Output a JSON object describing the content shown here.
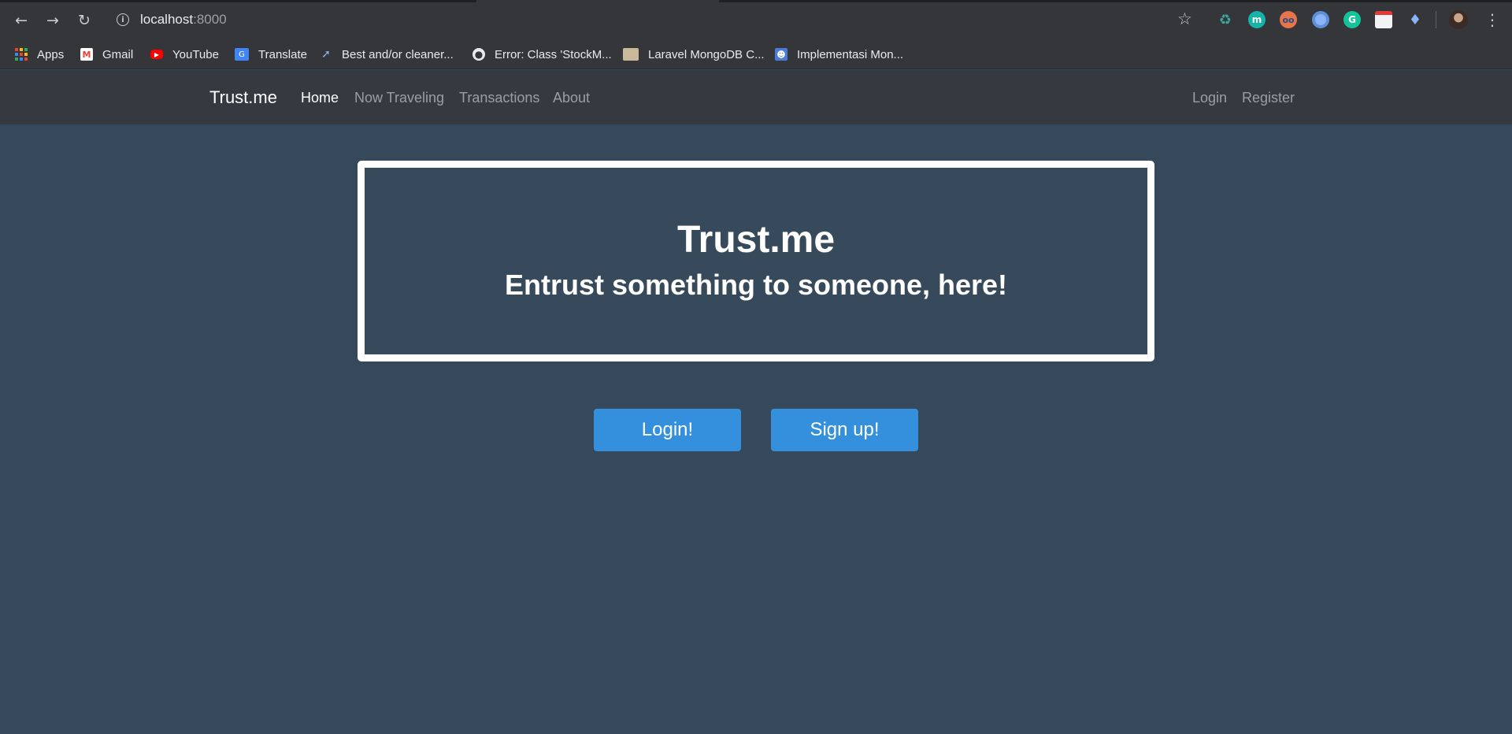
{
  "browser": {
    "url_host": "localhost",
    "url_port": ":8000",
    "bookmarks": [
      {
        "label": "Apps",
        "icon": "apps-grid-icon"
      },
      {
        "label": "Gmail",
        "icon": "gmail-icon"
      },
      {
        "label": "YouTube",
        "icon": "youtube-icon"
      },
      {
        "label": "Translate",
        "icon": "google-translate-icon"
      },
      {
        "label": "Best and/or cleaner...",
        "icon": "wand-icon"
      },
      {
        "label": "Error: Class 'StockM...",
        "icon": "globe-icon"
      },
      {
        "label": "Laravel MongoDB C...",
        "icon": "page-thumbnail-icon"
      },
      {
        "label": "Implementasi Mon...",
        "icon": "contact-icon"
      }
    ],
    "extensions": [
      "recycle-icon",
      "m-extension-icon",
      "eyes-extension-icon",
      "circle-extension-icon",
      "grammarly-icon",
      "calendar-extension-icon",
      "diamond-extension-icon"
    ]
  },
  "navbar": {
    "brand": "Trust.me",
    "links": [
      {
        "label": "Home",
        "active": true
      },
      {
        "label": "Now Traveling",
        "active": false
      },
      {
        "label": "Transactions",
        "active": false
      },
      {
        "label": "About",
        "active": false
      }
    ],
    "right_links": [
      {
        "label": "Login"
      },
      {
        "label": "Register"
      }
    ]
  },
  "hero": {
    "title": "Trust.me",
    "subtitle": "Entrust something to someone, here!"
  },
  "actions": {
    "login_label": "Login!",
    "signup_label": "Sign up!"
  },
  "colors": {
    "page_bg": "#35495a",
    "navbar_bg": "#343a40",
    "button_primary": "#3490dc"
  }
}
